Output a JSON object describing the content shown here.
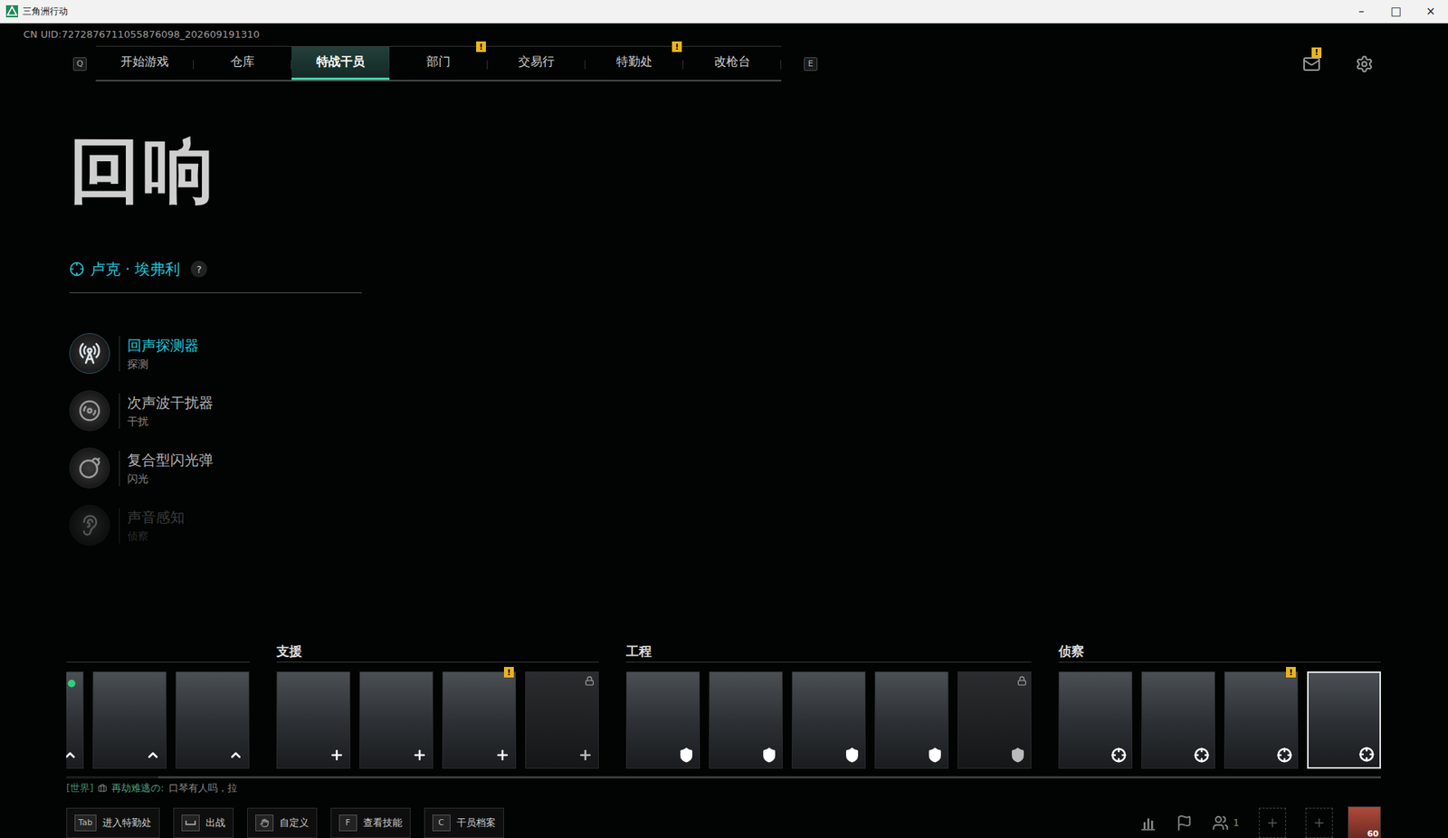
{
  "window": {
    "title": "三角洲行动",
    "controls": [
      "–",
      "□",
      "×"
    ]
  },
  "uid": "CN UID:7272876711055876098_202609191310",
  "nav": {
    "prev_key": "Q",
    "next_key": "E",
    "mail_badge": "!",
    "tabs": [
      {
        "label": "开始游戏",
        "selected": false,
        "badge": ""
      },
      {
        "label": "仓库",
        "selected": false,
        "badge": ""
      },
      {
        "label": "特战干员",
        "selected": true,
        "badge": ""
      },
      {
        "label": "部门",
        "selected": false,
        "badge": "!"
      },
      {
        "label": "交易行",
        "selected": false,
        "badge": ""
      },
      {
        "label": "特勤处",
        "selected": false,
        "badge": "!"
      },
      {
        "label": "改枪台",
        "selected": false,
        "badge": ""
      }
    ]
  },
  "operator": {
    "codename": "回响",
    "name": "卢克 · 埃弗利",
    "help": "?"
  },
  "skills": [
    {
      "name": "回声探测器",
      "type": "探测",
      "selected": true,
      "dimmed": false
    },
    {
      "name": "次声波干扰器",
      "type": "干扰",
      "selected": false,
      "dimmed": false
    },
    {
      "name": "复合型闪光弹",
      "type": "闪光",
      "selected": false,
      "dimmed": false
    },
    {
      "name": "声音感知",
      "type": "侦察",
      "selected": false,
      "dimmed": true
    }
  ],
  "roster": {
    "scroll": {
      "level": 0.93
    },
    "groups": [
      {
        "label": "",
        "cards": [
          {
            "kind": "assault",
            "locked": false,
            "selected": false,
            "badge": "",
            "new": true
          },
          {
            "kind": "assault",
            "locked": false,
            "selected": false,
            "badge": "",
            "new": false
          },
          {
            "kind": "assault",
            "locked": false,
            "selected": false,
            "badge": "",
            "new": false
          }
        ]
      },
      {
        "label": "支援",
        "cards": [
          {
            "kind": "support",
            "locked": false,
            "selected": false,
            "badge": "",
            "new": false
          },
          {
            "kind": "support",
            "locked": false,
            "selected": false,
            "badge": "",
            "new": false
          },
          {
            "kind": "support",
            "locked": false,
            "selected": false,
            "badge": "!",
            "new": false
          },
          {
            "kind": "support",
            "locked": true,
            "selected": false,
            "badge": "",
            "new": false
          }
        ]
      },
      {
        "label": "工程",
        "cards": [
          {
            "kind": "engineer",
            "locked": false,
            "selected": false,
            "badge": "",
            "new": false
          },
          {
            "kind": "engineer",
            "locked": false,
            "selected": false,
            "badge": "",
            "new": false
          },
          {
            "kind": "engineer",
            "locked": false,
            "selected": false,
            "badge": "",
            "new": false
          },
          {
            "kind": "engineer",
            "locked": false,
            "selected": false,
            "badge": "",
            "new": false
          },
          {
            "kind": "engineer",
            "locked": true,
            "selected": false,
            "badge": "",
            "new": false
          }
        ]
      },
      {
        "label": "侦察",
        "cards": [
          {
            "kind": "recon",
            "locked": false,
            "selected": false,
            "badge": "",
            "new": false
          },
          {
            "kind": "recon",
            "locked": false,
            "selected": false,
            "badge": "",
            "new": false
          },
          {
            "kind": "recon",
            "locked": false,
            "selected": false,
            "badge": "!",
            "new": false
          },
          {
            "kind": "recon",
            "locked": false,
            "selected": true,
            "badge": "",
            "new": false
          }
        ]
      }
    ]
  },
  "chat": {
    "channel": "[世界]",
    "sender": "再劫难逃の:",
    "message": "口琴有人吗，拉"
  },
  "actions": [
    {
      "key": "Tab",
      "key_kind": "text",
      "label": "进入特勤处"
    },
    {
      "key_kind": "space",
      "label": "出战"
    },
    {
      "key_kind": "icon",
      "label": "自定义"
    },
    {
      "key": "F",
      "key_kind": "text",
      "label": "查看技能"
    },
    {
      "key": "C",
      "key_kind": "text",
      "label": "干员档案"
    }
  ],
  "social": {
    "party_count": "1",
    "empty_slots": 2,
    "avatar_level": "60"
  }
}
